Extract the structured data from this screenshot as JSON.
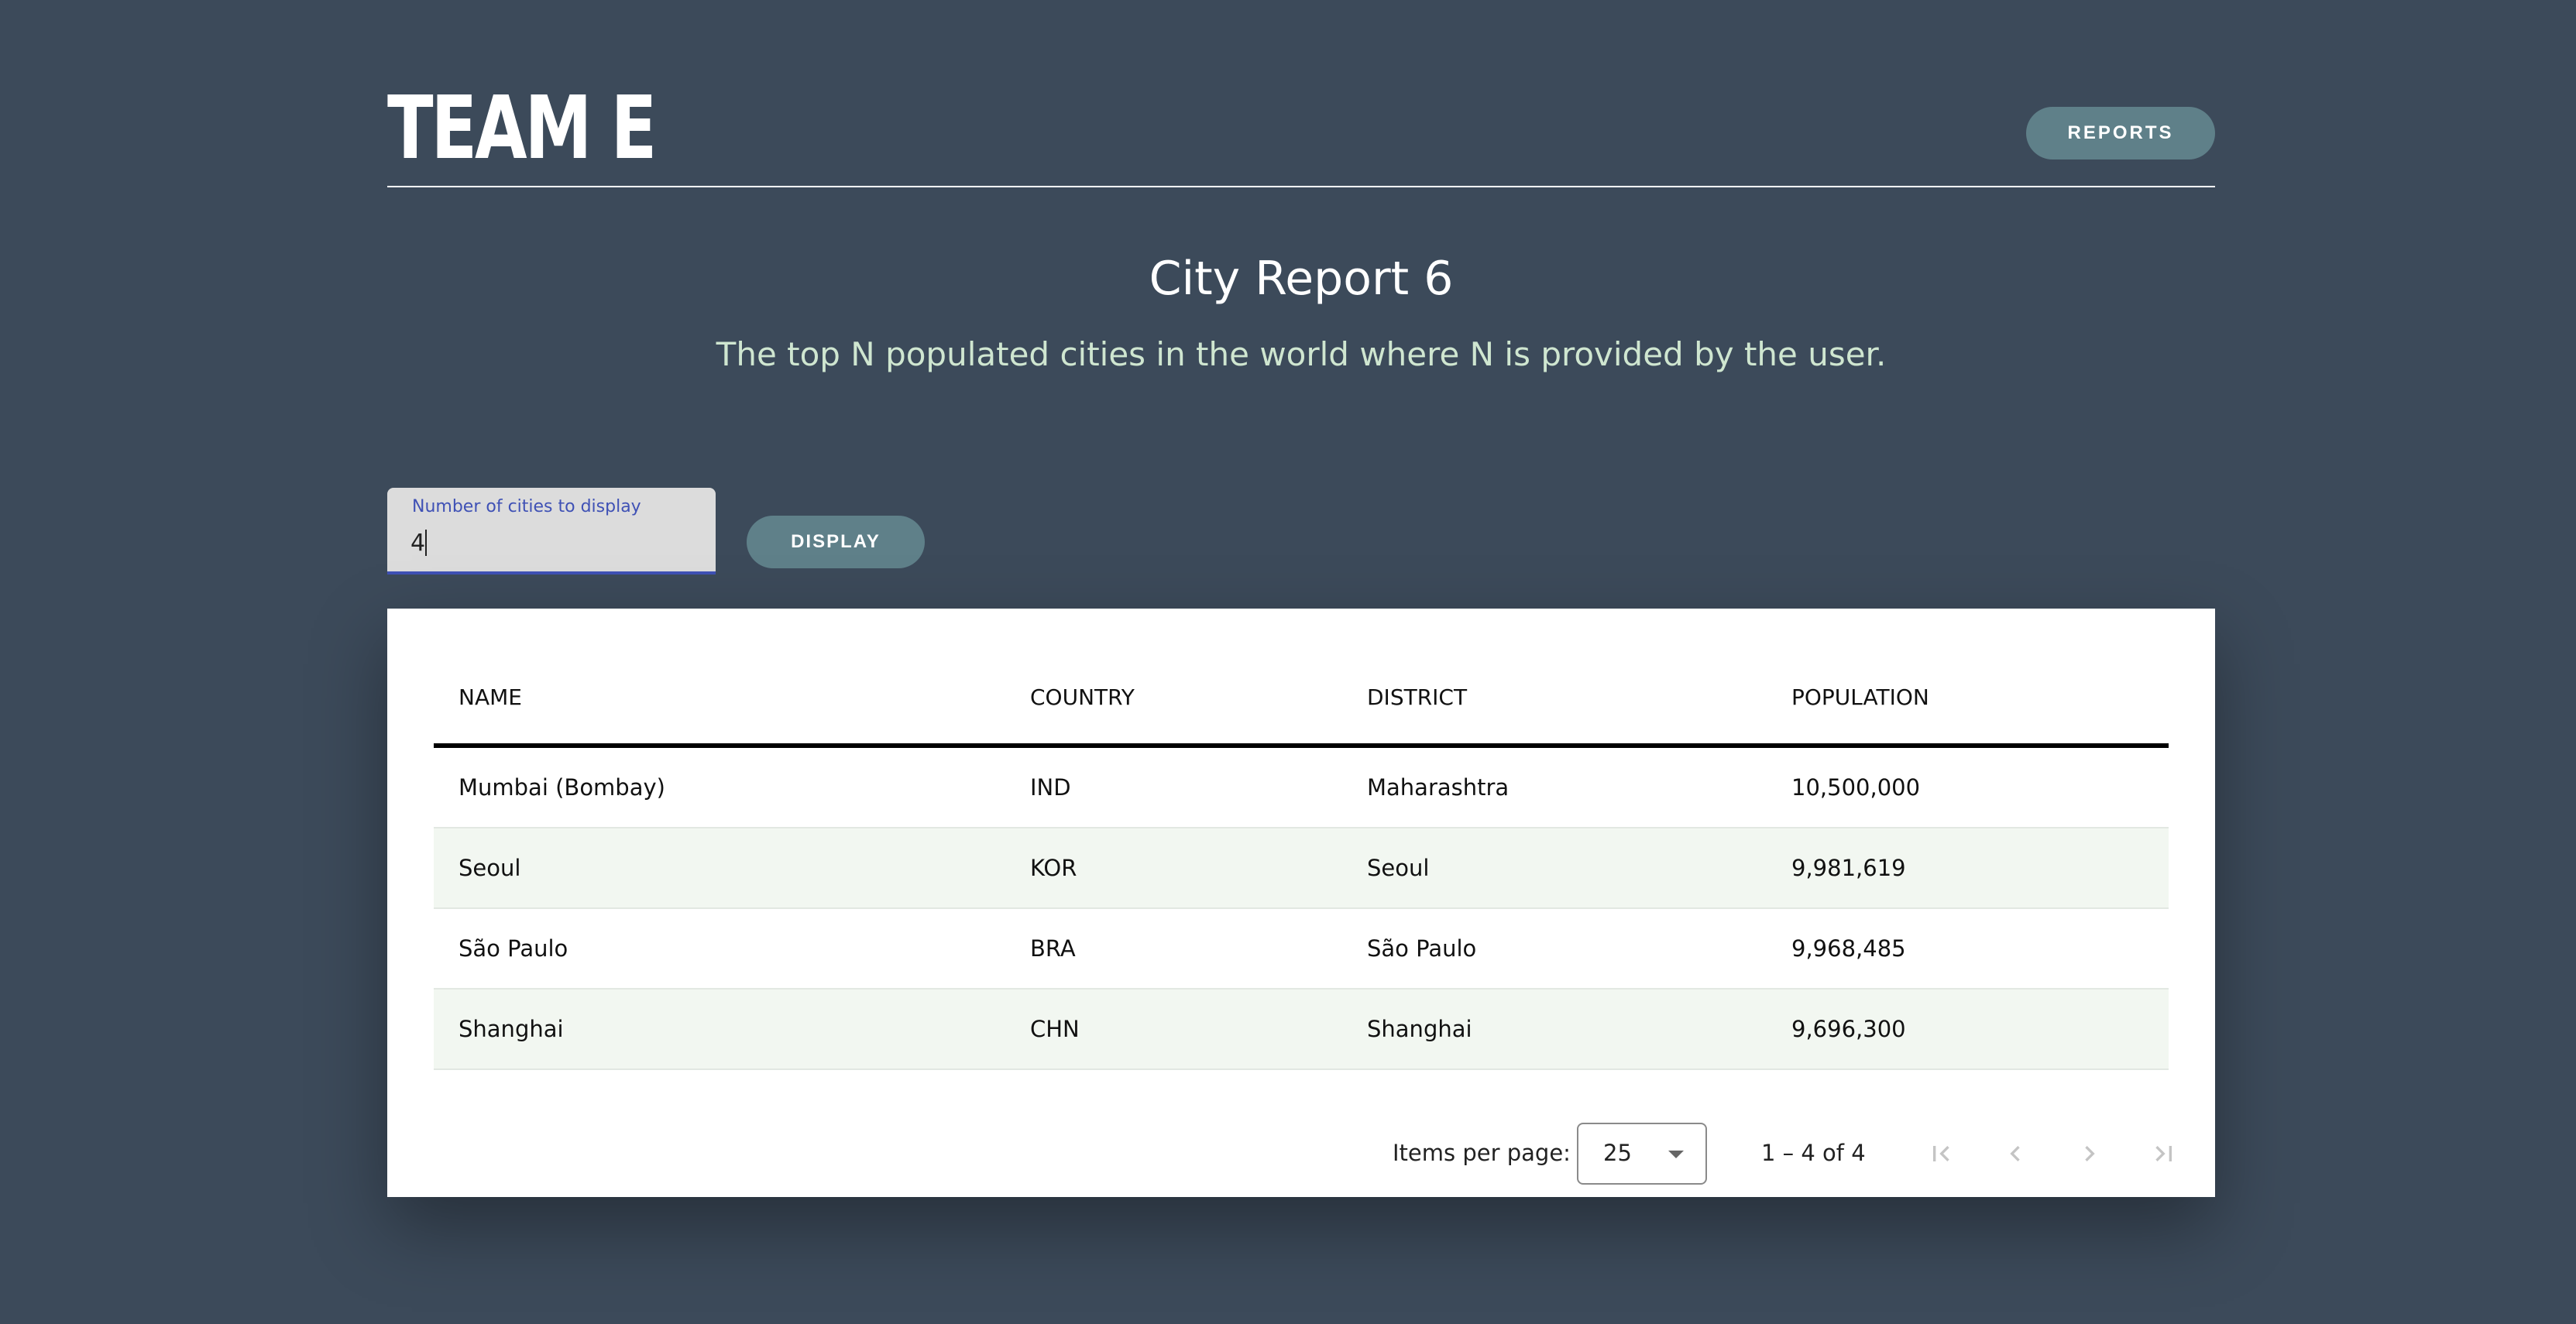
{
  "header": {
    "brand": "TEAM E",
    "reports_label": "REPORTS"
  },
  "report": {
    "title": "City Report 6",
    "subtitle": "The top N populated cities in the world where N is provided by the user."
  },
  "form": {
    "field_label": "Number of cities to display",
    "field_value": "4",
    "display_label": "DISPLAY"
  },
  "table": {
    "columns": [
      "NAME",
      "COUNTRY",
      "DISTRICT",
      "POPULATION"
    ],
    "rows": [
      [
        "Mumbai (Bombay)",
        "IND",
        "Maharashtra",
        "10,500,000"
      ],
      [
        "Seoul",
        "KOR",
        "Seoul",
        "9,981,619"
      ],
      [
        "São Paulo",
        "BRA",
        "São Paulo",
        "9,968,485"
      ],
      [
        "Shanghai",
        "CHN",
        "Shanghai",
        "9,696,300"
      ]
    ]
  },
  "paginator": {
    "items_per_page_label": "Items per page:",
    "items_per_page_value": "25",
    "range_label": "1 – 4 of 4",
    "icons": [
      "first-page-icon",
      "previous-page-icon",
      "next-page-icon",
      "last-page-icon"
    ]
  },
  "colors": {
    "background": "#3c4a5a",
    "button": "#5f8089",
    "subtitle": "#cfe6d0",
    "accent": "#3f51b5",
    "row_alt": "#f2f7f1"
  }
}
